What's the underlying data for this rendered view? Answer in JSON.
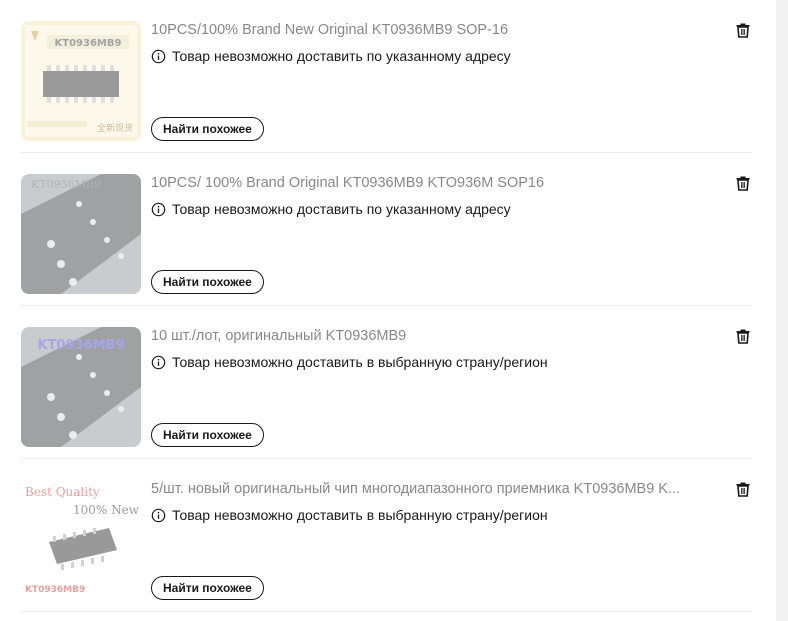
{
  "items": [
    {
      "title": "10PCS/100% Brand New Original KT0936MB9 SOP-16",
      "notice": "Товар невозможно доставить по указанному адресу",
      "button": "Найти похожее",
      "thumb_label": "KT0936MB9",
      "thumb_footer": "全新现货"
    },
    {
      "title": "10PCS/ 100% Brand Original KT0936MB9 KTO936M SOP16",
      "notice": "Товар невозможно доставить по указанному адресу",
      "button": "Найти похожее",
      "thumb_label": "KT0936MB9"
    },
    {
      "title": "10 шт./лот, оригинальный KT0936MB9",
      "notice": "Товар невозможно доставить в выбранную страну/регион",
      "button": "Найти похожее",
      "thumb_label": "KT0936MB9"
    },
    {
      "title": "5/шт. новый оригинальный чип многодиапазонного приемника KT0936MB9 K...",
      "notice": "Товар невозможно доставить в выбранную страну/регион",
      "button": "Найти похожее",
      "thumb_label": "KT0936MB9",
      "thumb_badge": "Best Quality",
      "thumb_sub": "100% New"
    }
  ],
  "icons": {
    "info": "info-circle-icon",
    "delete": "trash-icon"
  },
  "colors": {
    "title_muted": "#888888",
    "text": "#191919",
    "divider": "#ececec"
  }
}
